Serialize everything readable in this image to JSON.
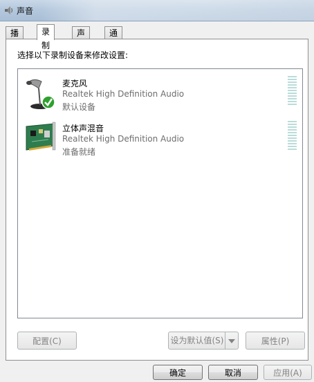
{
  "window": {
    "title": "声音"
  },
  "tabs": [
    {
      "label": "播放",
      "active": false
    },
    {
      "label": "录制",
      "active": true
    },
    {
      "label": "声音",
      "active": false
    },
    {
      "label": "通信",
      "active": false
    }
  ],
  "panel": {
    "instruction": "选择以下录制设备来修改设置:"
  },
  "devices": [
    {
      "name": "麦克风",
      "driver": "Realtek High Definition Audio",
      "status": "默认设备",
      "icon": "microphone-icon",
      "default": true,
      "level": 0
    },
    {
      "name": "立体声混音",
      "driver": "Realtek High Definition Audio",
      "status": "准备就绪",
      "icon": "sound-card-icon",
      "default": false,
      "level": 0
    }
  ],
  "actions": {
    "configure": "配置(C)",
    "set_default": "设为默认值(S)",
    "properties": "属性(P)"
  },
  "footer": {
    "ok": "确定",
    "cancel": "取消",
    "apply": "应用(A)"
  },
  "colors": {
    "meter": "#b9dcd9",
    "titlebar": "#b4c8dd",
    "check_green": "#2ea12e"
  }
}
